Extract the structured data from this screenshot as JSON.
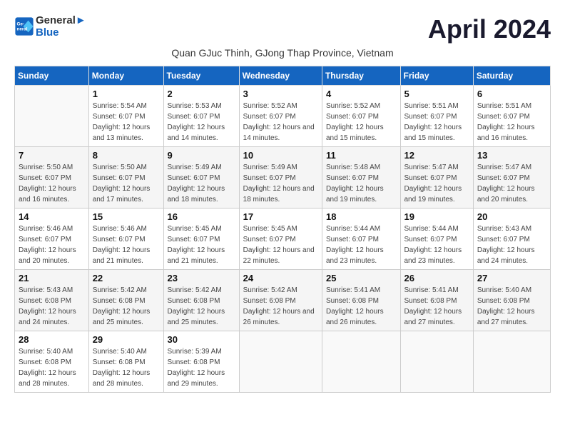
{
  "header": {
    "logo_line1": "General",
    "logo_line2": "Blue",
    "month_title": "April 2024",
    "subtitle": "Quan GJuc Thinh, GJong Thap Province, Vietnam"
  },
  "days_of_week": [
    "Sunday",
    "Monday",
    "Tuesday",
    "Wednesday",
    "Thursday",
    "Friday",
    "Saturday"
  ],
  "weeks": [
    [
      {
        "day": "",
        "sunrise": "",
        "sunset": "",
        "daylight": ""
      },
      {
        "day": "1",
        "sunrise": "5:54 AM",
        "sunset": "6:07 PM",
        "daylight": "12 hours and 13 minutes."
      },
      {
        "day": "2",
        "sunrise": "5:53 AM",
        "sunset": "6:07 PM",
        "daylight": "12 hours and 14 minutes."
      },
      {
        "day": "3",
        "sunrise": "5:52 AM",
        "sunset": "6:07 PM",
        "daylight": "12 hours and 14 minutes."
      },
      {
        "day": "4",
        "sunrise": "5:52 AM",
        "sunset": "6:07 PM",
        "daylight": "12 hours and 15 minutes."
      },
      {
        "day": "5",
        "sunrise": "5:51 AM",
        "sunset": "6:07 PM",
        "daylight": "12 hours and 15 minutes."
      },
      {
        "day": "6",
        "sunrise": "5:51 AM",
        "sunset": "6:07 PM",
        "daylight": "12 hours and 16 minutes."
      }
    ],
    [
      {
        "day": "7",
        "sunrise": "5:50 AM",
        "sunset": "6:07 PM",
        "daylight": "12 hours and 16 minutes."
      },
      {
        "day": "8",
        "sunrise": "5:50 AM",
        "sunset": "6:07 PM",
        "daylight": "12 hours and 17 minutes."
      },
      {
        "day": "9",
        "sunrise": "5:49 AM",
        "sunset": "6:07 PM",
        "daylight": "12 hours and 18 minutes."
      },
      {
        "day": "10",
        "sunrise": "5:49 AM",
        "sunset": "6:07 PM",
        "daylight": "12 hours and 18 minutes."
      },
      {
        "day": "11",
        "sunrise": "5:48 AM",
        "sunset": "6:07 PM",
        "daylight": "12 hours and 19 minutes."
      },
      {
        "day": "12",
        "sunrise": "5:47 AM",
        "sunset": "6:07 PM",
        "daylight": "12 hours and 19 minutes."
      },
      {
        "day": "13",
        "sunrise": "5:47 AM",
        "sunset": "6:07 PM",
        "daylight": "12 hours and 20 minutes."
      }
    ],
    [
      {
        "day": "14",
        "sunrise": "5:46 AM",
        "sunset": "6:07 PM",
        "daylight": "12 hours and 20 minutes."
      },
      {
        "day": "15",
        "sunrise": "5:46 AM",
        "sunset": "6:07 PM",
        "daylight": "12 hours and 21 minutes."
      },
      {
        "day": "16",
        "sunrise": "5:45 AM",
        "sunset": "6:07 PM",
        "daylight": "12 hours and 21 minutes."
      },
      {
        "day": "17",
        "sunrise": "5:45 AM",
        "sunset": "6:07 PM",
        "daylight": "12 hours and 22 minutes."
      },
      {
        "day": "18",
        "sunrise": "5:44 AM",
        "sunset": "6:07 PM",
        "daylight": "12 hours and 23 minutes."
      },
      {
        "day": "19",
        "sunrise": "5:44 AM",
        "sunset": "6:07 PM",
        "daylight": "12 hours and 23 minutes."
      },
      {
        "day": "20",
        "sunrise": "5:43 AM",
        "sunset": "6:07 PM",
        "daylight": "12 hours and 24 minutes."
      }
    ],
    [
      {
        "day": "21",
        "sunrise": "5:43 AM",
        "sunset": "6:08 PM",
        "daylight": "12 hours and 24 minutes."
      },
      {
        "day": "22",
        "sunrise": "5:42 AM",
        "sunset": "6:08 PM",
        "daylight": "12 hours and 25 minutes."
      },
      {
        "day": "23",
        "sunrise": "5:42 AM",
        "sunset": "6:08 PM",
        "daylight": "12 hours and 25 minutes."
      },
      {
        "day": "24",
        "sunrise": "5:42 AM",
        "sunset": "6:08 PM",
        "daylight": "12 hours and 26 minutes."
      },
      {
        "day": "25",
        "sunrise": "5:41 AM",
        "sunset": "6:08 PM",
        "daylight": "12 hours and 26 minutes."
      },
      {
        "day": "26",
        "sunrise": "5:41 AM",
        "sunset": "6:08 PM",
        "daylight": "12 hours and 27 minutes."
      },
      {
        "day": "27",
        "sunrise": "5:40 AM",
        "sunset": "6:08 PM",
        "daylight": "12 hours and 27 minutes."
      }
    ],
    [
      {
        "day": "28",
        "sunrise": "5:40 AM",
        "sunset": "6:08 PM",
        "daylight": "12 hours and 28 minutes."
      },
      {
        "day": "29",
        "sunrise": "5:40 AM",
        "sunset": "6:08 PM",
        "daylight": "12 hours and 28 minutes."
      },
      {
        "day": "30",
        "sunrise": "5:39 AM",
        "sunset": "6:08 PM",
        "daylight": "12 hours and 29 minutes."
      },
      {
        "day": "",
        "sunrise": "",
        "sunset": "",
        "daylight": ""
      },
      {
        "day": "",
        "sunrise": "",
        "sunset": "",
        "daylight": ""
      },
      {
        "day": "",
        "sunrise": "",
        "sunset": "",
        "daylight": ""
      },
      {
        "day": "",
        "sunrise": "",
        "sunset": "",
        "daylight": ""
      }
    ]
  ],
  "labels": {
    "sunrise_prefix": "Sunrise: ",
    "sunset_prefix": "Sunset: ",
    "daylight_prefix": "Daylight: "
  }
}
